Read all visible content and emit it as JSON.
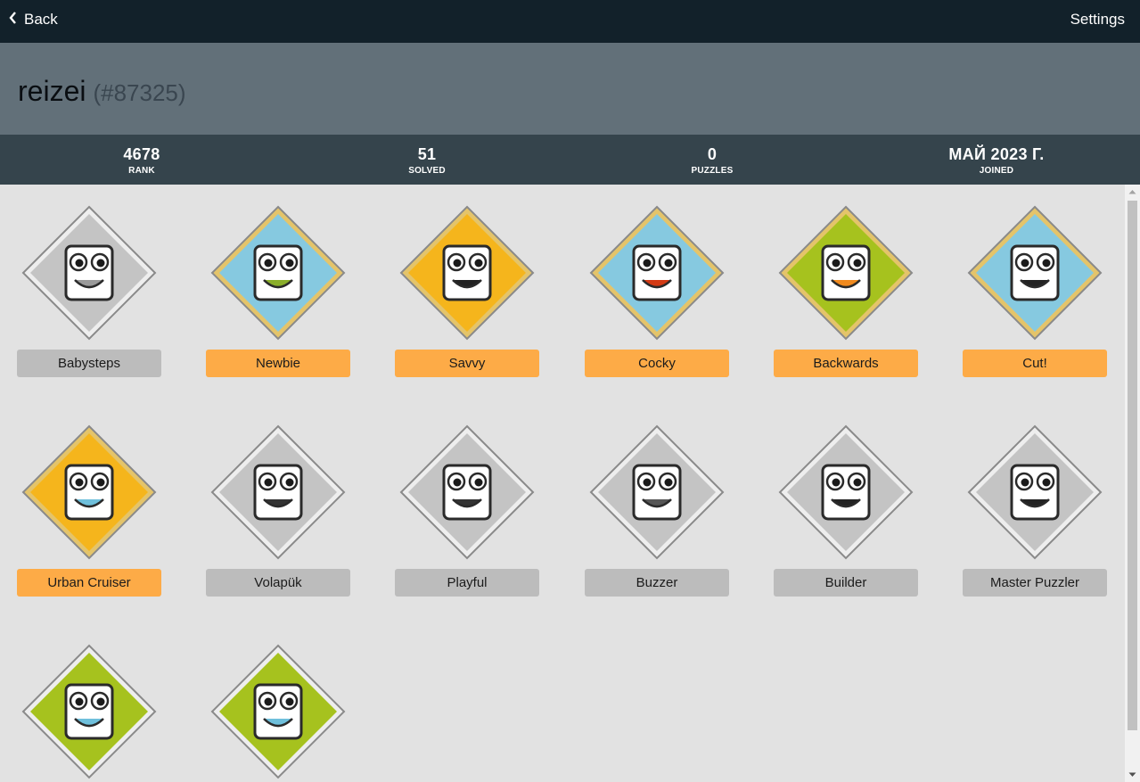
{
  "nav": {
    "back_label": "Back",
    "settings_label": "Settings"
  },
  "profile": {
    "username": "reizei",
    "user_id": "(#87325)"
  },
  "stats": [
    {
      "value": "4678",
      "label": "RANK"
    },
    {
      "value": "51",
      "label": "SOLVED"
    },
    {
      "value": "0",
      "label": "PUZZLES"
    },
    {
      "value": "МАЙ 2023 Г.",
      "label": "JOINED"
    }
  ],
  "colors": {
    "earned": "#fdab47",
    "unearned": "#bcbcbc",
    "topbar": "#12212a",
    "header": "#627079",
    "stats_bar": "#35444c"
  },
  "badges": [
    {
      "label": "Babysteps",
      "earned": false,
      "icon": "pacifier-badge-icon",
      "bg": "#c4c4c4",
      "accent": "#9a9a9a"
    },
    {
      "label": "Newbie",
      "earned": true,
      "icon": "explorer-hat-badge-icon",
      "bg": "#86c9e0",
      "accent": "#8aae2a"
    },
    {
      "label": "Savvy",
      "earned": true,
      "icon": "graduation-cap-badge-icon",
      "bg": "#f5b51c",
      "accent": "#222222"
    },
    {
      "label": "Cocky",
      "earned": true,
      "icon": "rooster-badge-icon",
      "bg": "#86c9e0",
      "accent": "#d23a14"
    },
    {
      "label": "Backwards",
      "earned": true,
      "icon": "abba-badge-icon",
      "bg": "#a6c21e",
      "accent": "#f08a1e"
    },
    {
      "label": "Cut!",
      "earned": true,
      "icon": "film-strip-badge-icon",
      "bg": "#86c9e0",
      "accent": "#222222"
    },
    {
      "label": "Urban Cruiser",
      "earned": true,
      "icon": "city-skyline-badge-icon",
      "bg": "#f5b51c",
      "accent": "#6fc0dc"
    },
    {
      "label": "Volapük",
      "earned": false,
      "icon": "question-face-badge-icon",
      "bg": "#c4c4c4",
      "accent": "#333333"
    },
    {
      "label": "Playful",
      "earned": false,
      "icon": "mustache-face-badge-icon",
      "bg": "#c4c4c4",
      "accent": "#333333"
    },
    {
      "label": "Buzzer",
      "earned": false,
      "icon": "bee-badge-icon",
      "bg": "#c4c4c4",
      "accent": "#555555"
    },
    {
      "label": "Builder",
      "earned": false,
      "icon": "blocks-badge-icon",
      "bg": "#c4c4c4",
      "accent": "#222222"
    },
    {
      "label": "Master Puzzler",
      "earned": false,
      "icon": "crossword-badge-icon",
      "bg": "#c4c4c4",
      "accent": "#222222"
    },
    {
      "label": "",
      "earned": false,
      "icon": "green-question-face-badge-icon",
      "bg": "#a6c21e",
      "accent": "#6fc0dc"
    },
    {
      "label": "",
      "earned": false,
      "icon": "green-question-face-badge-icon",
      "bg": "#a6c21e",
      "accent": "#6fc0dc"
    }
  ]
}
